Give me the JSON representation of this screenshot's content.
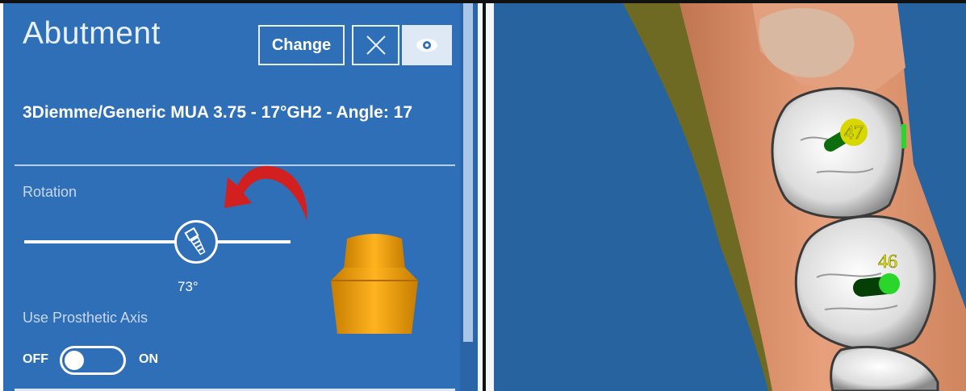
{
  "panel": {
    "title": "Abutment",
    "change_label": "Change",
    "close_icon": "close-icon",
    "eye_icon": "eye-icon",
    "model_name": "3Diemme/Generic MUA 3.75 - 17°GH2 - Angle: 17",
    "rotation_label": "Rotation",
    "rotation_value": "73°",
    "prosthetic_axis_label": "Use Prosthetic Axis",
    "toggle_off": "OFF",
    "toggle_on": "ON",
    "toggle_state": "off"
  },
  "viewport": {
    "tooth_labels": [
      "47",
      "46"
    ]
  },
  "colors": {
    "panel_bg": "#2f6fb8",
    "viewport_bg": "#27639f",
    "gum": "#e09a76",
    "tooth": "#e6e6e6",
    "abutment": "#f2a000",
    "implant_marker": "#2bd62b",
    "arrow": "#d21f1f",
    "label_yellow": "#f2f200"
  }
}
